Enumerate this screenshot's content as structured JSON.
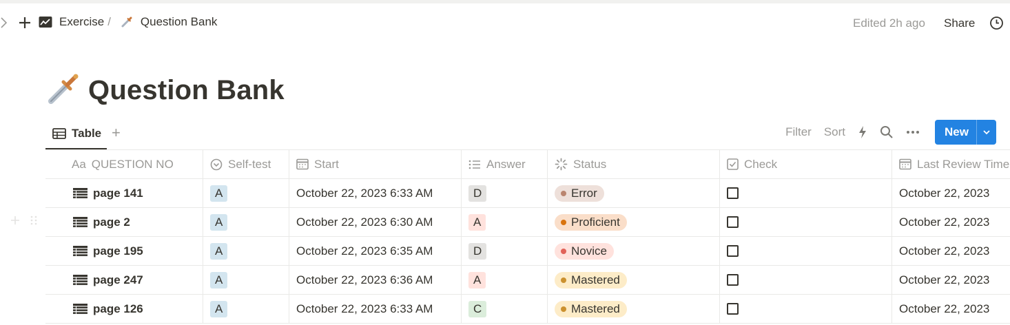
{
  "breadcrumb": {
    "parent": "Exercise",
    "separator": "/",
    "current": "Question Bank"
  },
  "topbar": {
    "edited": "Edited 2h ago",
    "share": "Share"
  },
  "page": {
    "title": "Question Bank"
  },
  "view": {
    "active_tab": "Table",
    "filter": "Filter",
    "sort": "Sort",
    "new_label": "New"
  },
  "table": {
    "columns": [
      {
        "label": "QUESTION NO",
        "icon": "title-text-icon"
      },
      {
        "label": "Self-test",
        "icon": "select-icon"
      },
      {
        "label": "Start",
        "icon": "calendar-icon"
      },
      {
        "label": "Answer",
        "icon": "list-icon"
      },
      {
        "label": "Status",
        "icon": "status-icon"
      },
      {
        "label": "Check",
        "icon": "checkbox-icon"
      },
      {
        "label": "Last Review Time",
        "icon": "calendar-icon"
      }
    ],
    "rows": [
      {
        "name": "page 141",
        "self_test": "A",
        "start": "October 22, 2023 6:33 AM",
        "answer": "D",
        "status": "Error",
        "check": false,
        "last_review": "October 22, 2023"
      },
      {
        "name": "page 2",
        "self_test": "A",
        "start": "October 22, 2023 6:30 AM",
        "answer": "A",
        "status": "Proficient",
        "check": false,
        "last_review": "October 22, 2023"
      },
      {
        "name": "page 195",
        "self_test": "A",
        "start": "October 22, 2023 6:35 AM",
        "answer": "D",
        "status": "Novice",
        "check": false,
        "last_review": "October 22, 2023"
      },
      {
        "name": "page 247",
        "self_test": "A",
        "start": "October 22, 2023 6:36 AM",
        "answer": "A",
        "status": "Mastered",
        "check": false,
        "last_review": "October 22, 2023"
      },
      {
        "name": "page 126",
        "self_test": "A",
        "start": "October 22, 2023 6:33 AM",
        "answer": "C",
        "status": "Mastered",
        "check": false,
        "last_review": "October 22, 2023"
      }
    ]
  },
  "colors": {
    "accent_blue": "#2383e2",
    "tag_blue_bg": "#d3e5ef",
    "tag_gray_bg": "#e3e2e0",
    "tag_red_bg": "#ffe2dd",
    "tag_green_bg": "#dbeddb",
    "status_error_bg": "#eee0da",
    "status_error_dot": "#ba856f",
    "status_proficient_bg": "#fadec9",
    "status_proficient_dot": "#d9730d",
    "status_novice_bg": "#ffe2dd",
    "status_novice_dot": "#e16259",
    "status_mastered_bg": "#fdecc8",
    "status_mastered_dot": "#cb912f"
  }
}
